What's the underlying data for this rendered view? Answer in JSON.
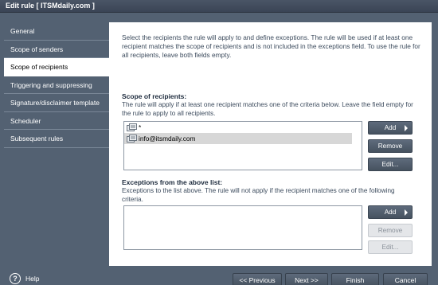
{
  "window": {
    "title": "Edit rule [ ITSMdaily.com ]"
  },
  "sidebar": {
    "items": [
      {
        "label": "General"
      },
      {
        "label": "Scope of senders"
      },
      {
        "label": "Scope of recipients"
      },
      {
        "label": "Triggering and suppressing"
      },
      {
        "label": "Signature/disclaimer template"
      },
      {
        "label": "Scheduler"
      },
      {
        "label": "Subsequent rules"
      }
    ],
    "help_label": "Help"
  },
  "main": {
    "intro": "Select the recipients the rule will apply to and define exceptions. The rule will be used if at least one recipient matches the scope of recipients and is not included in the exceptions field. To use the rule for all recipients, leave both fields empty.",
    "recipients": {
      "title": "Scope of recipients:",
      "desc": "The rule will apply if at least one recipient matches one of the criteria below. Leave the field empty for the rule to apply to all recipients.",
      "items": [
        "*",
        "info@itsmdaily.com"
      ],
      "add_label": "Add",
      "remove_label": "Remove",
      "edit_label": "Edit..."
    },
    "exceptions": {
      "title": "Exceptions from the above list:",
      "desc": "Exceptions to the list above. The rule will not apply if the recipient matches one of the following criteria.",
      "add_label": "Add",
      "remove_label": "Remove",
      "edit_label": "Edit..."
    }
  },
  "footer": {
    "previous_label": "<< Previous",
    "next_label": "Next >>",
    "finish_label": "Finish",
    "cancel_label": "Cancel"
  }
}
